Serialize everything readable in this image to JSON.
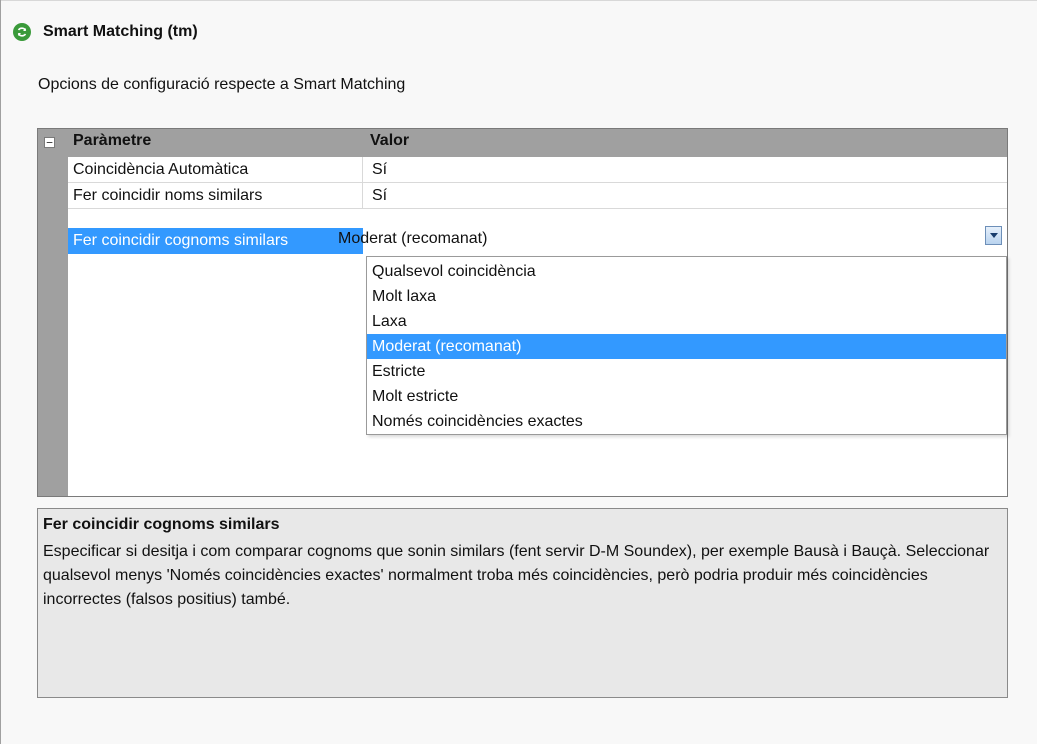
{
  "header": {
    "title": "Smart Matching (tm)",
    "icon": "refresh-icon"
  },
  "subtitle": "Opcions de configuració respecte a Smart Matching",
  "grid": {
    "collapse_symbol": "−",
    "col_param": "Paràmetre",
    "col_valor": "Valor",
    "rows": [
      {
        "name": "Coincidència Automàtica",
        "value": "Sí"
      },
      {
        "name": "Fer coincidir noms similars",
        "value": "Sí"
      },
      {
        "name": "Fer coincidir cognoms similars",
        "value": "Moderat (recomanat)"
      }
    ]
  },
  "dropdown": {
    "selected": "Moderat (recomanat)",
    "options": [
      "Qualsevol coincidència",
      "Molt laxa",
      "Laxa",
      "Moderat (recomanat)",
      "Estricte",
      "Molt estricte",
      "Només coincidències exactes"
    ]
  },
  "description": {
    "title": "Fer coincidir cognoms similars",
    "text": "Especificar si desitja i com comparar cognoms que sonin similars (fent servir D-M Soundex), per exemple Bausà i Bauçà. Seleccionar qualsevol menys 'Només coincidències exactes' normalment troba més coincidències, però podria produir més coincidències incorrectes (falsos positius) també."
  },
  "colors": {
    "selection": "#3399ff",
    "grid_bg": "#a0a0a0",
    "desc_bg": "#e8e8e8"
  }
}
